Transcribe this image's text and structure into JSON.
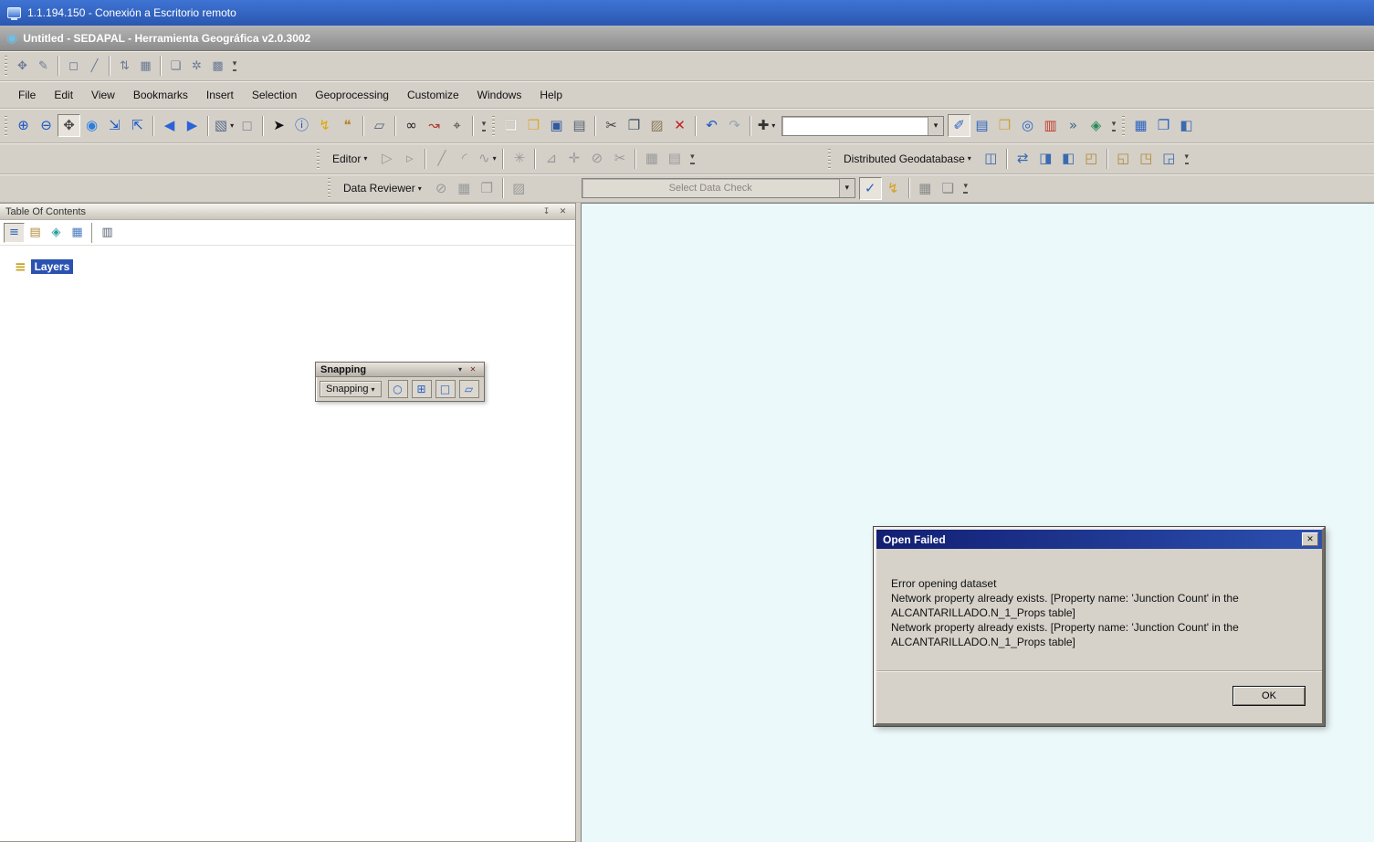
{
  "remote_bar": {
    "title": "1.1.194.150 - Conexión a Escritorio remoto"
  },
  "app": {
    "title": "Untitled - SEDAPAL - Herramienta Geográfica v2.0.3002"
  },
  "glyphs": {
    "app_icon": "◉",
    "chevron_down": "▾",
    "close": "✕",
    "pin": "↧",
    "layers": "≡"
  },
  "colors": {
    "map_background": "#ecf9fa",
    "selection_highlight": "#2a52b0",
    "dialog_title": "#1b2f7a",
    "remote_bar": "#2f5fc0"
  },
  "menubar": {
    "items": [
      "File",
      "Edit",
      "View",
      "Bookmarks",
      "Insert",
      "Selection",
      "Geoprocessing",
      "Customize",
      "Windows",
      "Help"
    ]
  },
  "toolbar1": {
    "icons": [
      {
        "name": "network-flags-tool-icon",
        "glyph": "✥",
        "color": "#6b7a94"
      },
      {
        "name": "sketch-edit-tool-icon",
        "glyph": "✎",
        "color": "#6b7a94"
      },
      {
        "sep": true
      },
      {
        "name": "selection-box-tool-icon",
        "glyph": "◻",
        "color": "#6b7a94"
      },
      {
        "name": "trace-line-tool-icon",
        "glyph": "╱",
        "color": "#6b7a94"
      },
      {
        "sep": true
      },
      {
        "name": "sort-order-tool-icon",
        "glyph": "⇅",
        "color": "#6b7a94"
      },
      {
        "name": "grid-tool-icon",
        "glyph": "▦",
        "color": "#6b7a94"
      },
      {
        "sep": true
      },
      {
        "name": "table-pair-tool-icon",
        "glyph": "❏",
        "color": "#6b7a94"
      },
      {
        "name": "star-tool-icon",
        "glyph": "✲",
        "color": "#6b7a94"
      },
      {
        "name": "matrix-tool-icon",
        "glyph": "▩",
        "color": "#6b7a94"
      },
      {
        "name": "mini-toolbar-options-icon",
        "glyph": "▾",
        "color": "#444444",
        "chev": true
      }
    ]
  },
  "toolbar_main": {
    "icons_left": [
      {
        "name": "zoom-in-icon",
        "glyph": "⊕",
        "color": "#1a57c6"
      },
      {
        "name": "zoom-out-icon",
        "glyph": "⊖",
        "color": "#1a57c6"
      },
      {
        "name": "pan-icon",
        "glyph": "✥",
        "color": "#444444",
        "pressed": true
      },
      {
        "name": "full-extent-icon",
        "glyph": "◉",
        "color": "#2b7de0"
      },
      {
        "name": "fixed-zoom-in-icon",
        "glyph": "⇲",
        "color": "#1a57c6"
      },
      {
        "name": "fixed-zoom-out-icon",
        "glyph": "⇱",
        "color": "#1a57c6"
      },
      {
        "sep": true
      },
      {
        "name": "back-extent-icon",
        "glyph": "◀",
        "color": "#2b62d9"
      },
      {
        "name": "forward-extent-icon",
        "glyph": "▶",
        "color": "#2b62d9"
      },
      {
        "sep": true
      },
      {
        "name": "select-features-icon",
        "glyph": "▧",
        "color": "#55698a",
        "dropdown": true
      },
      {
        "name": "clear-selected-features-icon",
        "glyph": "◻",
        "color": "#8a8f98"
      },
      {
        "sep": true
      },
      {
        "name": "select-elements-icon",
        "glyph": "➤",
        "color": "#111111"
      },
      {
        "name": "identify-icon",
        "glyph": "ⓘ",
        "color": "#1a57c6"
      },
      {
        "name": "hyperlink-icon",
        "glyph": "↯",
        "color": "#e0a800"
      },
      {
        "name": "html-popup-icon",
        "glyph": "❝",
        "color": "#b8862a"
      },
      {
        "sep": true
      },
      {
        "name": "measure-icon",
        "glyph": "▱",
        "color": "#55607a"
      },
      {
        "sep": true
      },
      {
        "name": "find-icon",
        "glyph": "∞",
        "color": "#222222"
      },
      {
        "name": "find-route-icon",
        "glyph": "↝",
        "color": "#b23a2a"
      },
      {
        "name": "go-to-xy-icon",
        "glyph": "⌖",
        "color": "#444444"
      },
      {
        "sep": true
      },
      {
        "name": "tools-toolbar-options-icon",
        "glyph": "▾",
        "color": "#444444",
        "chev": true
      }
    ],
    "icons_std": [
      {
        "grip": true
      },
      {
        "name": "new-map-icon",
        "glyph": "❏",
        "color": "#fcfcfc",
        "light": true
      },
      {
        "name": "open-icon",
        "glyph": "❒",
        "color": "#e0a52e"
      },
      {
        "name": "save-icon",
        "glyph": "▣",
        "color": "#33589c"
      },
      {
        "name": "print-icon",
        "glyph": "▤",
        "color": "#556070"
      },
      {
        "sep": true
      },
      {
        "name": "cut-icon",
        "glyph": "✂",
        "color": "#444444"
      },
      {
        "name": "copy-icon",
        "glyph": "❐",
        "color": "#445566"
      },
      {
        "name": "paste-icon",
        "glyph": "▨",
        "color": "#8a7a5a"
      },
      {
        "name": "delete-icon",
        "glyph": "✕",
        "color": "#c22222"
      },
      {
        "sep": true
      },
      {
        "name": "undo-icon",
        "glyph": "↶",
        "color": "#1a57c6"
      },
      {
        "name": "redo-icon",
        "glyph": "↷",
        "color": "#9aa4ae",
        "disabled": true
      },
      {
        "sep": true
      },
      {
        "name": "add-data-icon",
        "glyph": "✚",
        "color": "#333333",
        "dropdown": true
      }
    ],
    "scale_value": "",
    "icons_right": [
      {
        "name": "editor-toolbar-toggle-icon",
        "glyph": "✐",
        "color": "#2a62c0",
        "pressed": true
      },
      {
        "name": "toc-window-icon",
        "glyph": "▤",
        "color": "#2a62c0"
      },
      {
        "name": "catalog-window-icon",
        "glyph": "❒",
        "color": "#caa23a"
      },
      {
        "name": "search-window-icon",
        "glyph": "◎",
        "color": "#2a62c0"
      },
      {
        "name": "toolbox-window-icon",
        "glyph": "▥",
        "color": "#c03a2a"
      },
      {
        "name": "python-window-icon",
        "glyph": "»",
        "color": "#3a6a8a"
      },
      {
        "name": "modelbuilder-window-icon",
        "glyph": "◈",
        "color": "#2a8a5a"
      },
      {
        "name": "standard-toolbar-options-icon",
        "glyph": "▾",
        "color": "#444444",
        "chev": true
      },
      {
        "grip": true
      },
      {
        "name": "attribute-table-icon",
        "glyph": "▦",
        "color": "#2a62c0"
      },
      {
        "name": "overflow-tool-icon",
        "glyph": "❐",
        "color": "#2a62c0"
      },
      {
        "name": "georeferencing-tool-icon",
        "glyph": "◧",
        "color": "#3a6ab0"
      }
    ]
  },
  "editor_toolbar": {
    "label": "Editor",
    "icons": [
      {
        "name": "edit-tool-icon",
        "glyph": "▷",
        "color": "#9a9a9a",
        "disabled": true
      },
      {
        "name": "edit-annotation-tool-icon",
        "glyph": "▹",
        "color": "#9a9a9a",
        "disabled": true
      },
      {
        "sep": true
      },
      {
        "name": "straight-segment-icon",
        "glyph": "╱",
        "color": "#9a9a9a",
        "disabled": true
      },
      {
        "name": "endpoint-arc-segment-icon",
        "glyph": "◜",
        "color": "#9a9a9a",
        "disabled": true
      },
      {
        "name": "trace-tool-icon",
        "glyph": "∿",
        "color": "#9a9a9a",
        "disabled": true,
        "dropdown": true
      },
      {
        "sep": true
      },
      {
        "name": "rotate-tool-icon",
        "glyph": "✳",
        "color": "#9a9a9a",
        "disabled": true
      },
      {
        "sep": true
      },
      {
        "name": "reshape-feature-icon",
        "glyph": "⊿",
        "color": "#9a9a9a",
        "disabled": true
      },
      {
        "name": "move-tool-icon",
        "glyph": "✛",
        "color": "#9a9a9a",
        "disabled": true
      },
      {
        "name": "cut-polygons-icon",
        "glyph": "⊘",
        "color": "#9a9a9a",
        "disabled": true
      },
      {
        "name": "split-tool-icon",
        "glyph": "✂",
        "color": "#9a9a9a",
        "disabled": true
      },
      {
        "sep": true
      },
      {
        "name": "attributes-icon",
        "glyph": "▦",
        "color": "#9a9a9a",
        "disabled": true
      },
      {
        "name": "sketch-properties-icon",
        "glyph": "▤",
        "color": "#9a9a9a",
        "disabled": true
      },
      {
        "name": "editor-toolbar-options-icon",
        "glyph": "▾",
        "color": "#444444",
        "chev": true
      }
    ]
  },
  "dgdb_toolbar": {
    "label": "Distributed Geodatabase",
    "icons": [
      {
        "name": "create-replica-icon",
        "glyph": "◫",
        "color": "#3a6ab0"
      },
      {
        "sep": true
      },
      {
        "name": "synchronize-changes-icon",
        "glyph": "⇄",
        "color": "#3a6ab0"
      },
      {
        "name": "export-data-changes-icon",
        "glyph": "◨",
        "color": "#3a6ab0"
      },
      {
        "name": "import-message-icon",
        "glyph": "◧",
        "color": "#3a6ab0"
      },
      {
        "name": "export-acknowledgement-icon",
        "glyph": "◰",
        "color": "#b08a3a"
      },
      {
        "sep": true
      },
      {
        "name": "export-xml-workspace-icon",
        "glyph": "◱",
        "color": "#b08a3a"
      },
      {
        "name": "import-xml-workspace-icon",
        "glyph": "◳",
        "color": "#b08a3a"
      },
      {
        "name": "extract-data-icon",
        "glyph": "◲",
        "color": "#3a6ab0"
      },
      {
        "name": "dgdb-toolbar-options-icon",
        "glyph": "▾",
        "color": "#444444",
        "chev": true
      }
    ]
  },
  "reviewer_toolbar": {
    "label": "Data Reviewer",
    "icons_left": [
      {
        "name": "reviewer-session-icon",
        "glyph": "⊘",
        "color": "#9a9a9a",
        "disabled": true
      },
      {
        "name": "reviewer-table-icon",
        "glyph": "▦",
        "color": "#9a9a9a",
        "disabled": true
      },
      {
        "name": "browse-features-icon",
        "glyph": "❐",
        "color": "#9a9a9a",
        "disabled": true
      },
      {
        "sep": true
      },
      {
        "name": "select-data-check-icon",
        "glyph": "▨",
        "color": "#9a9a9a",
        "disabled": true
      }
    ],
    "combo_value": "Select Data Check",
    "icons_right": [
      {
        "name": "run-data-check-icon",
        "glyph": "✓",
        "color": "#2a62c0",
        "pressed": true
      },
      {
        "name": "batch-validate-icon",
        "glyph": "↯",
        "color": "#d8a018"
      },
      {
        "sep": true
      },
      {
        "name": "reviewer-results-icon",
        "glyph": "▦",
        "color": "#8a8a8a"
      },
      {
        "name": "commit-results-icon",
        "glyph": "❏",
        "color": "#8a8a8a"
      },
      {
        "name": "reviewer-toolbar-options-icon",
        "glyph": "▾",
        "color": "#444444",
        "chev": true
      }
    ]
  },
  "toc": {
    "title": "Table Of Contents",
    "toolbar_icons": [
      {
        "name": "list-by-drawing-order-icon",
        "glyph": "≡",
        "color": "#2a62c0",
        "pressed": true
      },
      {
        "name": "list-by-source-icon",
        "glyph": "▤",
        "color": "#b08a3a"
      },
      {
        "name": "list-by-visibility-icon",
        "glyph": "◈",
        "color": "#2aa0a0"
      },
      {
        "name": "list-by-selection-icon",
        "glyph": "▦",
        "color": "#4a7ac0"
      },
      {
        "sep": true
      },
      {
        "name": "toc-options-icon",
        "glyph": "▥",
        "color": "#556070"
      }
    ],
    "layers_label": "Layers"
  },
  "snapping": {
    "title": "Snapping",
    "button_label": "Snapping",
    "icons": [
      {
        "name": "point-snapping-icon",
        "glyph": "○",
        "color": "#2a62c0",
        "framed": true
      },
      {
        "name": "end-snapping-icon",
        "glyph": "⊞",
        "color": "#2a62c0",
        "framed": true
      },
      {
        "name": "vertex-snapping-icon",
        "glyph": "□",
        "color": "#2a62c0",
        "framed": true
      },
      {
        "name": "edge-snapping-icon",
        "glyph": "▱",
        "color": "#2a62c0",
        "framed": true
      }
    ]
  },
  "dialog": {
    "title": "Open Failed",
    "lines": [
      "Error opening dataset",
      "Network property already exists. [Property name: 'Junction Count' in the ALCANTARILLADO.N_1_Props table]",
      "Network property already exists. [Property name: 'Junction Count' in the ALCANTARILLADO.N_1_Props table]"
    ],
    "ok_label": "OK"
  }
}
